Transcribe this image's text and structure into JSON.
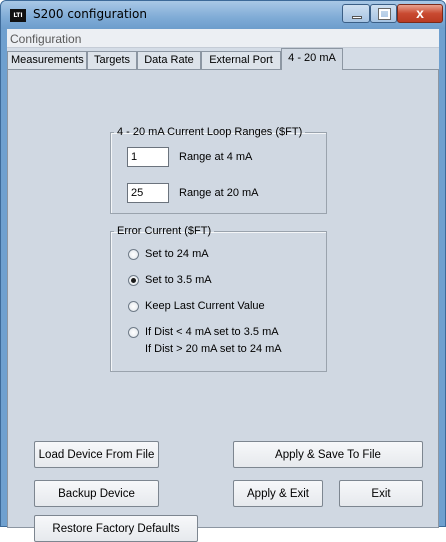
{
  "window": {
    "title": "S200 configuration",
    "icon_text": "LTI",
    "close_glyph": "x"
  },
  "menu": {
    "items": [
      "Configuration"
    ]
  },
  "tabs": [
    {
      "label": "Measurements",
      "active": false
    },
    {
      "label": "Targets",
      "active": false
    },
    {
      "label": "Data Rate",
      "active": false
    },
    {
      "label": "External Port",
      "active": false
    },
    {
      "label": "4 - 20 mA",
      "active": true
    }
  ],
  "range_group": {
    "legend": "4 - 20 mA Current Loop Ranges  ($FT)",
    "range4": {
      "value": "1",
      "label": "Range at 4 mA"
    },
    "range20": {
      "value": "25",
      "label": "Range at 20 mA"
    }
  },
  "error_group": {
    "legend": "Error Current  ($FT)",
    "options": [
      {
        "label": "Set to 24 mA",
        "checked": false
      },
      {
        "label": "Set to 3.5 mA",
        "checked": true
      },
      {
        "label": "Keep Last Current Value",
        "checked": false
      },
      {
        "label": "If Dist < 4 mA set to 3.5 mA",
        "checked": false
      }
    ],
    "option4_line2": "If Dist  > 20 mA set to 24 mA"
  },
  "buttons": {
    "load": "Load Device From File",
    "apply_save": "Apply & Save To File",
    "backup": "Backup Device",
    "apply_exit": "Apply & Exit",
    "exit": "Exit",
    "restore": "Restore Factory Defaults"
  }
}
